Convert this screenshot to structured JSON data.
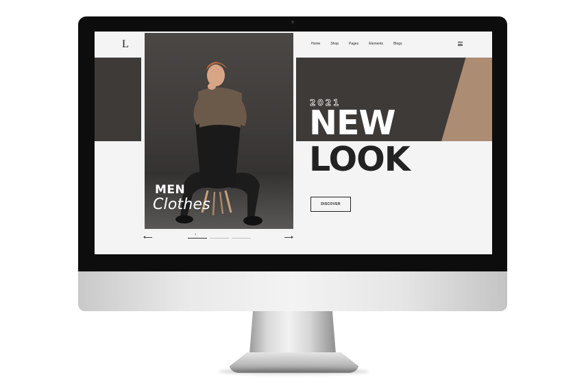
{
  "site": {
    "logo_text": "L",
    "nav": [
      "Home",
      "Shop",
      "Pages",
      "Elements",
      "Blogs"
    ],
    "menu_icon": "hamburger-icon"
  },
  "hero": {
    "title_line1": "MEN",
    "title_line2": "Clothes",
    "year": "2021",
    "headline_line1": "NEW",
    "headline_line2": "LOOK",
    "cta_label": "DISCOVER"
  },
  "slider": {
    "current_page": "1",
    "prev_icon": "arrow-left-icon",
    "next_icon": "arrow-right-icon"
  },
  "colors": {
    "dark_band": "#3d3a38",
    "accent_tan": "#ad8c74",
    "screen_bg": "#f4f4f4",
    "text_dark": "#222222"
  }
}
